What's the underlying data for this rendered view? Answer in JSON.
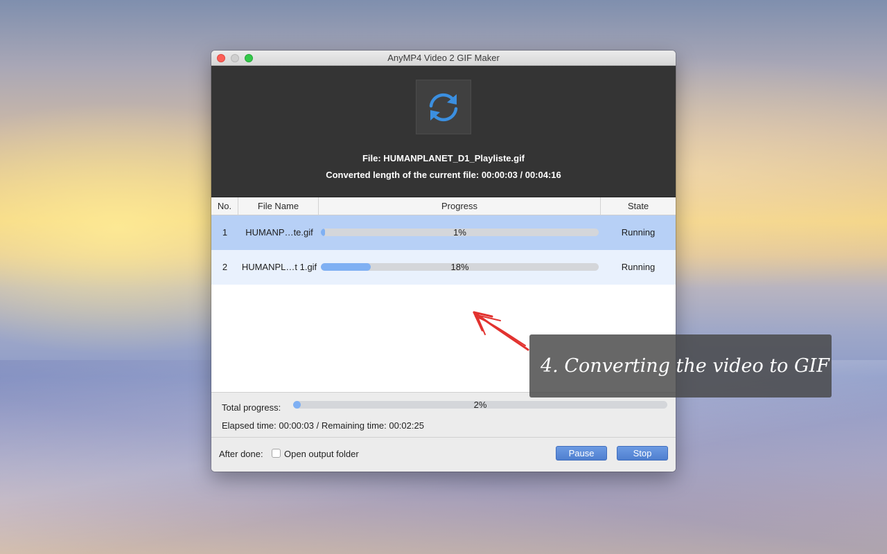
{
  "window": {
    "title": "AnyMP4 Video 2 GIF Maker"
  },
  "header": {
    "icon": "convert-refresh-icon",
    "file_line": "File: HUMANPLANET_D1_Playliste.gif",
    "length_line": "Converted length of the current file: 00:00:03 / 00:04:16"
  },
  "table": {
    "columns": [
      "No.",
      "File Name",
      "Progress",
      "State"
    ],
    "rows": [
      {
        "no": "1",
        "file_name": "HUMANP…te.gif",
        "progress": 1,
        "progress_label": "1%",
        "state": "Running"
      },
      {
        "no": "2",
        "file_name": "HUMANPL…t 1.gif",
        "progress": 18,
        "progress_label": "18%",
        "state": "Running"
      }
    ]
  },
  "footer": {
    "total_label": "Total progress:",
    "total_progress": 2,
    "total_label_pct": "2%",
    "times": "Elapsed time: 00:00:03 / Remaining time: 00:02:25",
    "after_done_label": "After done:",
    "open_folder_label": "Open output folder",
    "open_folder_checked": false,
    "pause_label": "Pause",
    "stop_label": "Stop"
  },
  "annotation": {
    "text": "4. Converting the video to GIF"
  },
  "colors": {
    "accent": "#7fb0f3",
    "selected_row": "#b7d0f6",
    "button": "#5b8ad8",
    "header_bg": "#343434"
  }
}
